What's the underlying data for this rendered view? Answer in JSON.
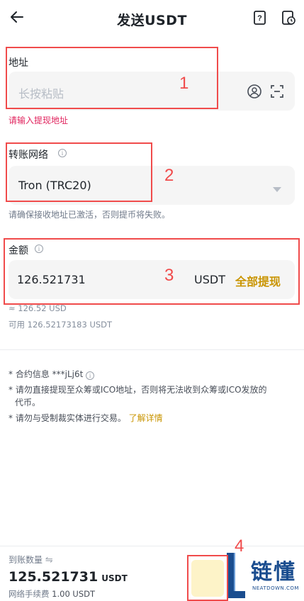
{
  "header": {
    "title": "发送USDT"
  },
  "address": {
    "label": "地址",
    "placeholder": "长按粘贴",
    "error": "请输入提现地址"
  },
  "network": {
    "label": "转账网络",
    "value": "Tron (TRC20)",
    "hint": "请确保接收地址已激活，否则提币将失败。"
  },
  "amount": {
    "label": "金额",
    "value": "126.521731",
    "unit": "USDT",
    "max_label": "全部提现",
    "approx": "≈ 126.52 USD",
    "available_label": "可用",
    "available_value": "126.52173183 USDT"
  },
  "notes": {
    "contract": "* 合约信息 ***jLj6t",
    "warning1_line1": "* 请勿直接提现至众筹或ICO地址，否则将无法收到众筹或ICO发放的",
    "warning1_line2": "代币。",
    "warning2": "* 请勿与受制裁实体进行交易。",
    "learn_more": "了解详情"
  },
  "footer": {
    "receive_label": "到账数量",
    "receive_value": "125.521731",
    "receive_unit": "USDT",
    "fee_label": "网络手续费",
    "fee_value": "1.00 USDT"
  },
  "annotations": {
    "n1": "1",
    "n2": "2",
    "n3": "3",
    "n4": "4"
  },
  "watermark": {
    "text": "链懂",
    "domain": "NEATDOWN.COM"
  },
  "colors": {
    "accent": "#c99400",
    "error": "#e0245e",
    "annotation_red": "#f04b4b",
    "field_bg": "#f5f5f5"
  }
}
